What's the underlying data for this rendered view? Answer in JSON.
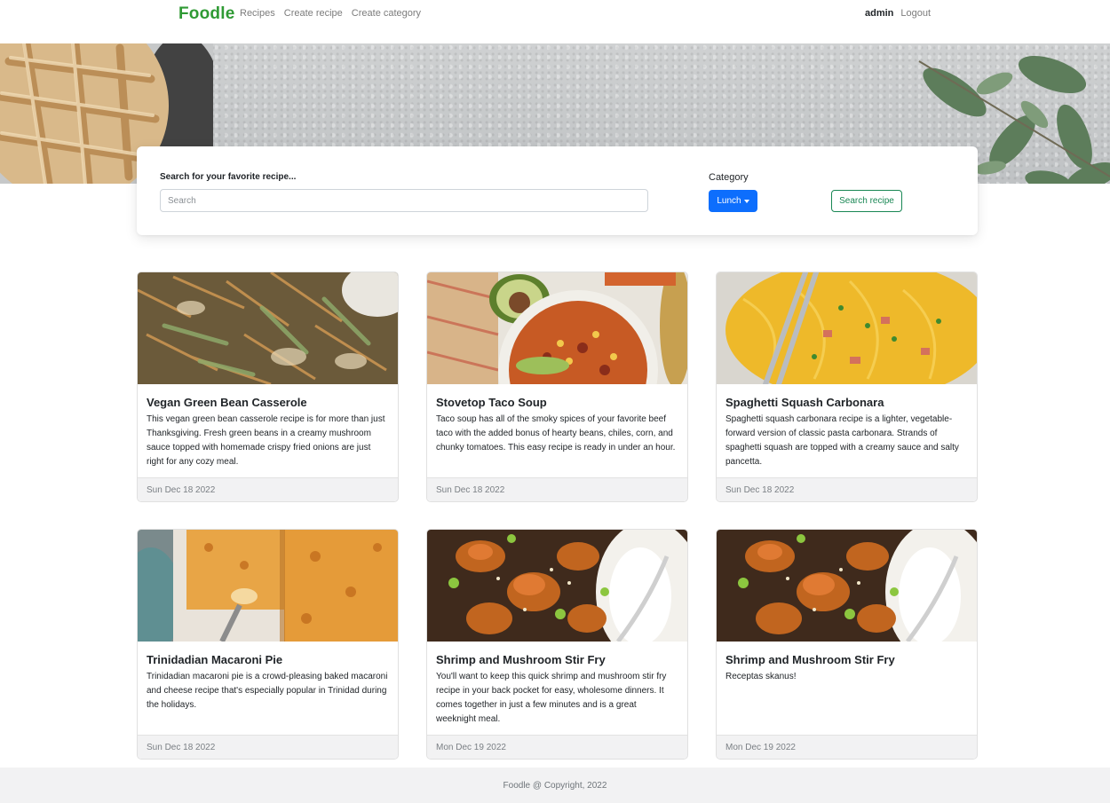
{
  "navbar": {
    "brand": "Foodle",
    "links": [
      "Recipes",
      "Create recipe",
      "Create category"
    ],
    "user": "admin",
    "logout": "Logout"
  },
  "search": {
    "label": "Search for your favorite recipe...",
    "placeholder": "Search",
    "value": "",
    "category_label": "Category",
    "category_selected": "Lunch",
    "button": "Search recipe"
  },
  "recipes": [
    {
      "title": "Vegan Green Bean Casserole",
      "description": "This vegan green bean casserole recipe is for more than just Thanksgiving. Fresh green beans in a creamy mushroom sauce topped with homemade crispy fried onions are just right for any cozy meal.",
      "date": "Sun Dec 18 2022"
    },
    {
      "title": "Stovetop Taco Soup",
      "description": "Taco soup has all of the smoky spices of your favorite beef taco with the added bonus of hearty beans, chiles, corn, and chunky tomatoes. This easy recipe is ready in under an hour.",
      "date": "Sun Dec 18 2022"
    },
    {
      "title": "Spaghetti Squash Carbonara",
      "description": "Spaghetti squash carbonara recipe is a lighter, vegetable-forward version of classic pasta carbonara. Strands of spaghetti squash are topped with a creamy sauce and salty pancetta.",
      "date": "Sun Dec 18 2022"
    },
    {
      "title": "Trinidadian Macaroni Pie",
      "description": "Trinidadian macaroni pie is a crowd-pleasing baked macaroni and cheese recipe that's especially popular in Trinidad during the holidays.",
      "date": "Sun Dec 18 2022"
    },
    {
      "title": "Shrimp and Mushroom Stir Fry",
      "description": "You'll want to keep this quick shrimp and mushroom stir fry recipe in your back pocket for easy, wholesome dinners. It comes together in just a few minutes and is a great weeknight meal.",
      "date": "Mon Dec 19 2022"
    },
    {
      "title": "Shrimp and Mushroom Stir Fry",
      "description": "Receptas skanus!",
      "date": "Mon Dec 19 2022"
    }
  ],
  "footer": {
    "text": "Foodle @ Copyright, 2022"
  },
  "colors": {
    "brand": "#2f9a34",
    "primary": "#0d6efd",
    "success": "#198754"
  }
}
